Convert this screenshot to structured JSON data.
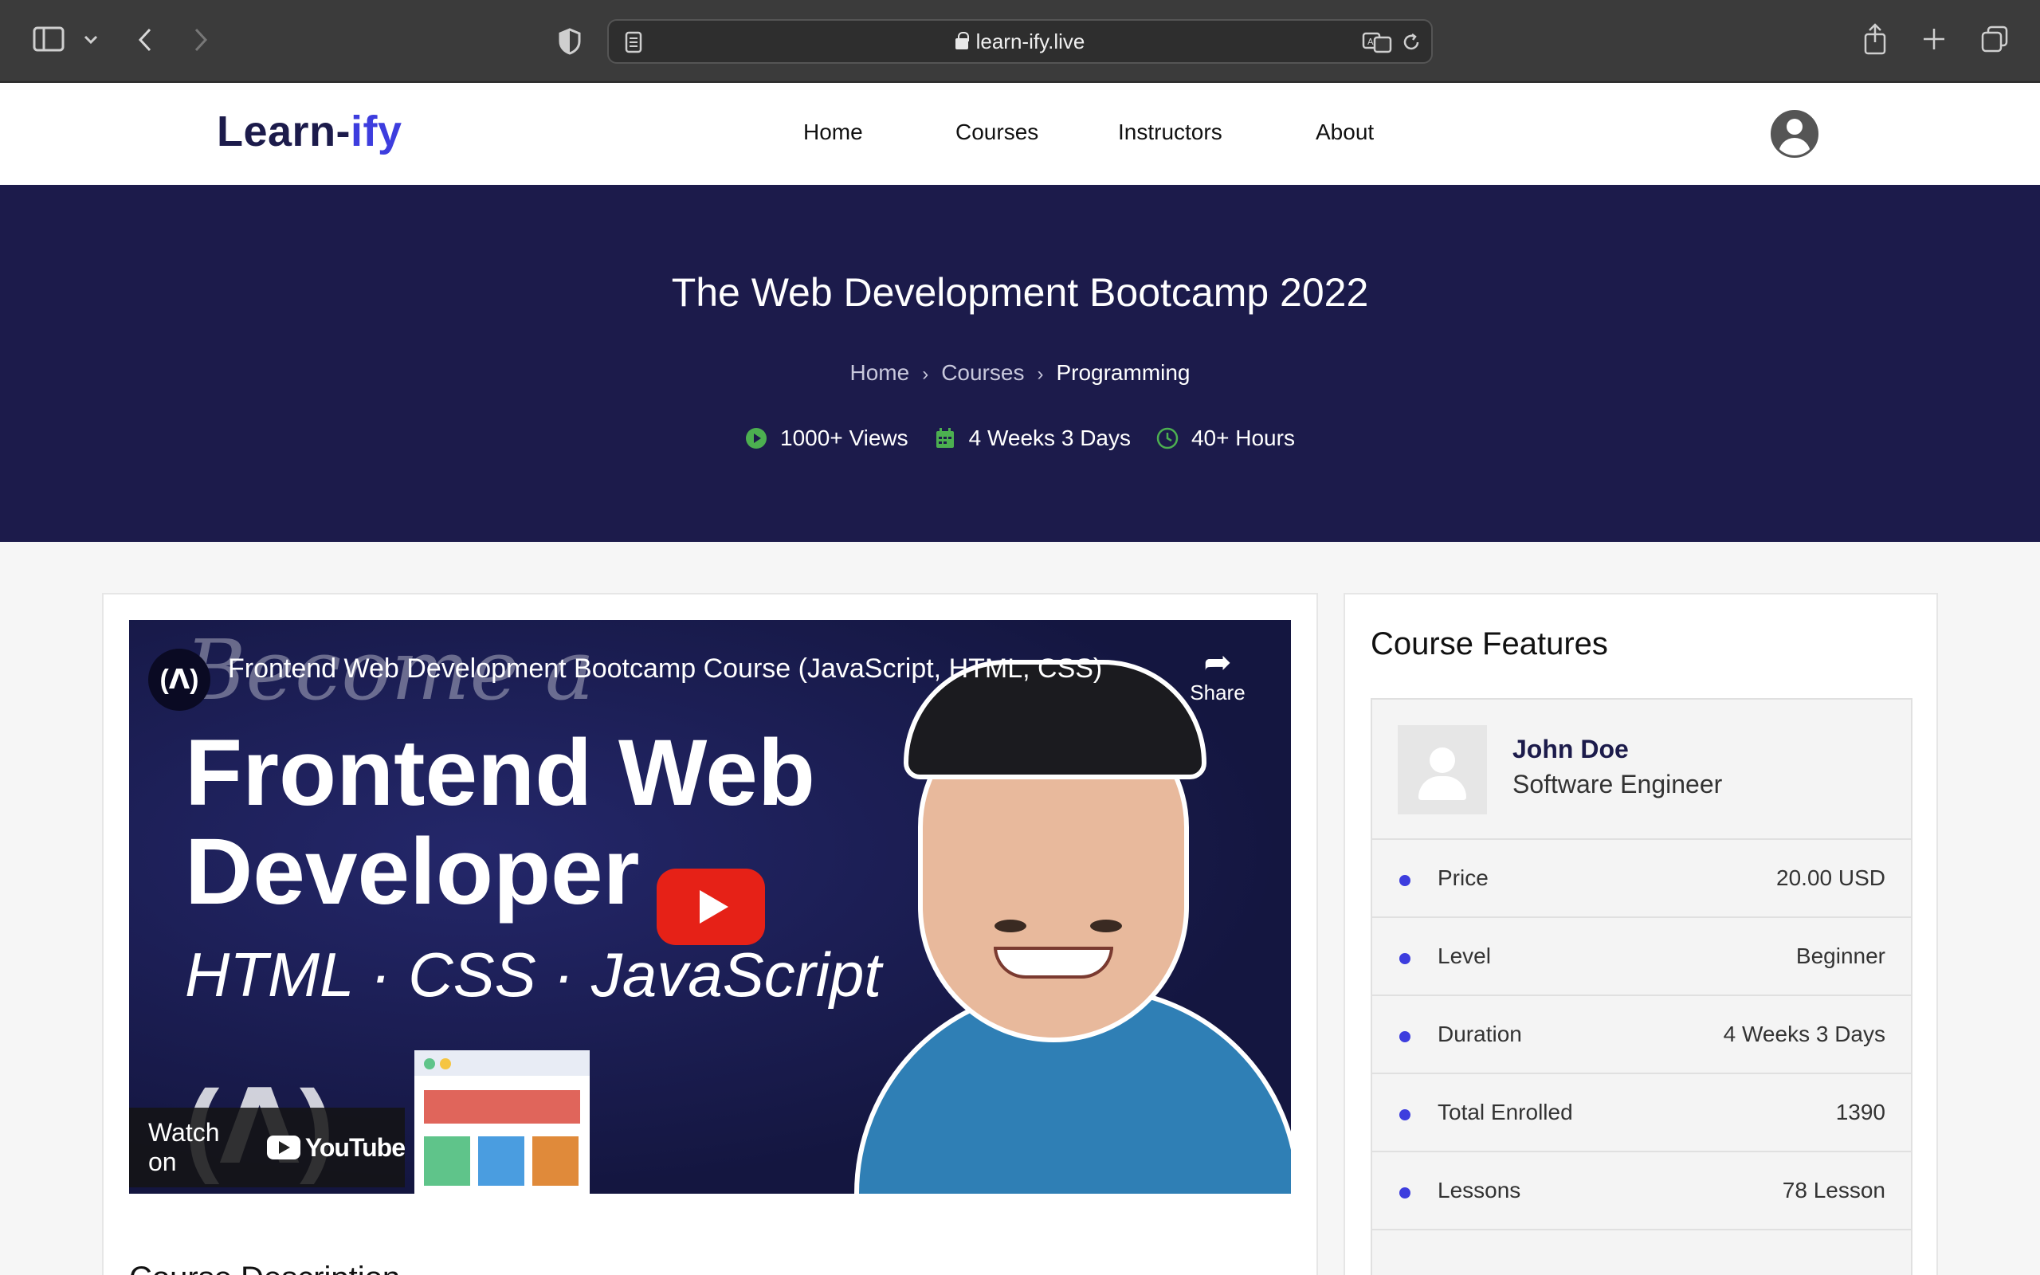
{
  "browser": {
    "url": "learn-ify.live"
  },
  "header": {
    "logo_main": "Learn-",
    "logo_accent": "ify",
    "nav": [
      "Home",
      "Courses",
      "Instructors",
      "About"
    ]
  },
  "hero": {
    "title": "The Web Development Bootcamp 2022",
    "breadcrumb": [
      "Home",
      "Courses",
      "Programming"
    ],
    "meta": [
      {
        "icon": "play-circle-icon",
        "text": "1000+ Views"
      },
      {
        "icon": "calendar-icon",
        "text": "4 Weeks 3 Days"
      },
      {
        "icon": "clock-icon",
        "text": "40+ Hours"
      }
    ],
    "accent_color": "#4caf50"
  },
  "video": {
    "title": "Frontend Web Development Bootcamp Course (JavaScript, HTML, CSS)",
    "share_label": "Share",
    "thumb_line1": "Become a",
    "thumb_line2": "Frontend Web",
    "thumb_line3": "Developer",
    "thumb_tech": "HTML · CSS · JavaScript",
    "watch_on": "Watch on",
    "youtube": "YouTube"
  },
  "description": {
    "title": "Course Description"
  },
  "features": {
    "title": "Course Features",
    "instructor": {
      "name": "John Doe",
      "role": "Software Engineer"
    },
    "rows": [
      {
        "label": "Price",
        "value": "20.00 USD"
      },
      {
        "label": "Level",
        "value": "Beginner"
      },
      {
        "label": "Duration",
        "value": "4 Weeks 3 Days"
      },
      {
        "label": "Total Enrolled",
        "value": "1390"
      },
      {
        "label": "Lessons",
        "value": "78 Lesson"
      }
    ],
    "bullet_color": "#3d3dde"
  }
}
